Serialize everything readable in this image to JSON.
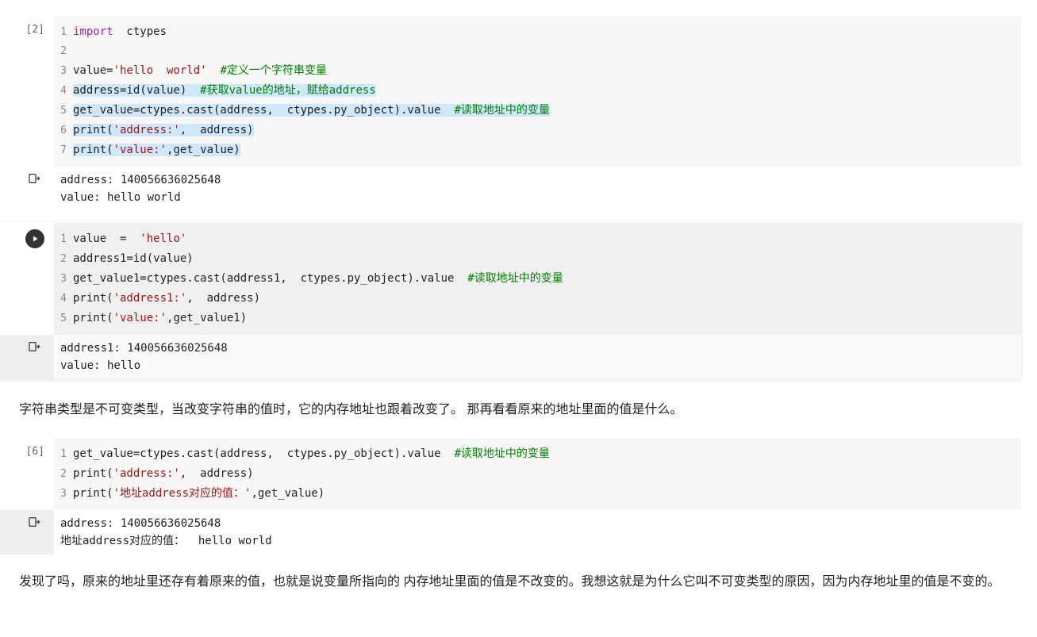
{
  "cells": [
    {
      "exec": "[2]",
      "lines": [
        {
          "n": "1",
          "html": "<span class='kw'>import</span>  ctypes"
        },
        {
          "n": "2",
          "html": ""
        },
        {
          "n": "3",
          "html": "value=<span class='str'>'hello  world'</span>  <span class='cmt'>#定义一个字符串变量</span>"
        },
        {
          "n": "4",
          "html": "<span class='highlight'>address=id(value)  <span class='cmt'>#获取value的地址，赋给address</span></span>"
        },
        {
          "n": "5",
          "html": "<span class='highlight'>get_value=ctypes.cast(address,  ctypes.py_object).value  <span class='cmt'>#读取地址中的变量</span></span>"
        },
        {
          "n": "6",
          "html": "<span class='highlight'>print(<span class='str'>'address:'</span>,  address)</span>"
        },
        {
          "n": "7",
          "html": "<span class='highlight'>print(<span class='str'>'value:'</span>,get_value)</span>"
        }
      ],
      "output": "address: 140056636025648\nvalue: hello world"
    },
    {
      "run_icon": true,
      "lines": [
        {
          "n": "1",
          "html": "value  =  <span class='str'>'hello'</span>"
        },
        {
          "n": "2",
          "html": "address1=id(value)"
        },
        {
          "n": "3",
          "html": "get_value1=ctypes.cast(address1,  ctypes.py_object).value  <span class='cmt'>#读取地址中的变量</span>"
        },
        {
          "n": "4",
          "html": "print(<span class='str'>'address1:'</span>,  address)"
        },
        {
          "n": "5",
          "html": "print(<span class='str'>'value:'</span>,get_value1)"
        }
      ],
      "output": "address1: 140056636025648\nvalue: hello"
    }
  ],
  "markdown1": "字符串类型是不可变类型，当改变字符串的值时，它的内存地址也跟着改变了。 那再看看原来的地址里面的值是什么。",
  "cell3": {
    "exec": "[6]",
    "lines": [
      {
        "n": "1",
        "html": "get_value=ctypes.cast(address,  ctypes.py_object).value  <span class='cmt'>#读取地址中的变量</span>"
      },
      {
        "n": "2",
        "html": "print(<span class='str'>'address:'</span>,  address)"
      },
      {
        "n": "3",
        "html": "print(<span class='str'>'地址address对应的值：'</span>,get_value)"
      }
    ],
    "output": "address: 140056636025648\n地址address对应的值：  hello world"
  },
  "markdown2": "发现了吗，原来的地址里还存有着原来的值，也就是说变量所指向的 内存地址里面的值是不改变的。我想这就是为什么它叫不可变类型的原因，因为内存地址里的值是不变的。"
}
